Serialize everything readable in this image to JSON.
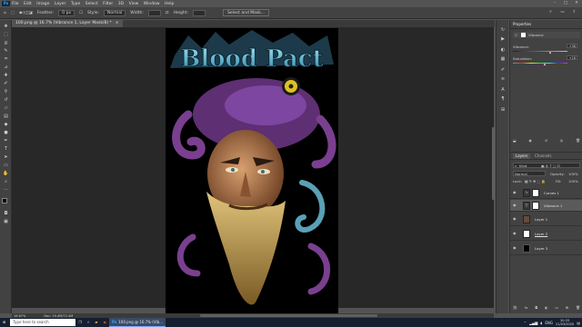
{
  "menu": [
    "File",
    "Edit",
    "Image",
    "Layer",
    "Type",
    "Select",
    "Filter",
    "3D",
    "View",
    "Window",
    "Help"
  ],
  "app_logo": "Ps",
  "options_bar": {
    "feather_label": "Feather:",
    "feather_value": "0 px",
    "style_label": "Style:",
    "style_value": "Normal",
    "width_label": "Width:",
    "height_label": "Height:",
    "select_mask_button": "Select and Mask..."
  },
  "document_tab": {
    "title": "100.png @ 16.7% (Vibrance 1, Layer Mask/8) *",
    "close": "×"
  },
  "artwork": {
    "title_text": "Blood Pact",
    "colors": {
      "title": "#3aa7c6",
      "tentacle": "#7a3f8f",
      "skin": "#b67a4a",
      "beard": "#c9a55b",
      "eye_gold": "#e0c020"
    }
  },
  "status": {
    "zoom": "16.67%",
    "doc_info": "Doc: 19.4M/72.4M"
  },
  "properties_panel": {
    "tab": "Properties",
    "adjustment_name": "Vibrance",
    "vibrance_label": "Vibrance:",
    "vibrance_value": "+38",
    "vibrance_pct": 0.69,
    "saturation_label": "Saturation:",
    "saturation_value": "+18",
    "saturation_pct": 0.59
  },
  "layers_panel": {
    "tabs": [
      "Layers",
      "Channels"
    ],
    "kind_filter": "Kind",
    "blend_mode": "Normal",
    "opacity_label": "Opacity:",
    "opacity_value": "100%",
    "lock_label": "Lock:",
    "fill_label": "Fill:",
    "fill_value": "100%",
    "layers": [
      {
        "name": "Curves 1",
        "selected": false
      },
      {
        "name": "Vibrance 1",
        "selected": true
      },
      {
        "name": "Layer 1",
        "selected": false
      },
      {
        "name": "Layer 2",
        "selected": false
      },
      {
        "name": "Layer 3",
        "selected": false
      }
    ]
  },
  "taskbar": {
    "search_placeholder": "Type here to search",
    "app_label": "100.png @ 16.7% (Vib...",
    "language": "ENG",
    "time": "20:33",
    "date": "21/03/2020"
  }
}
